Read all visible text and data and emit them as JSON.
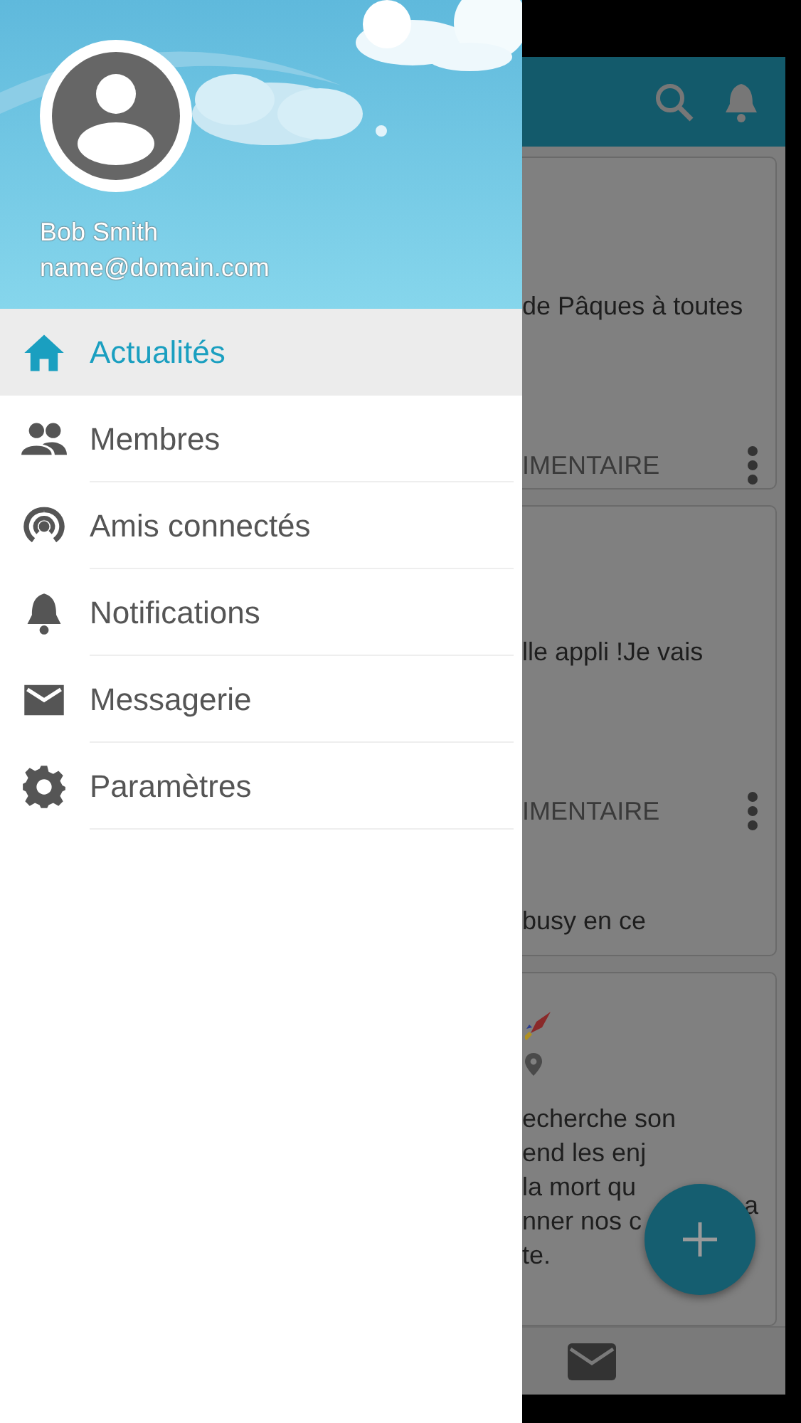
{
  "drawer": {
    "user": {
      "name": "Bob Smith",
      "email": "name@domain.com"
    },
    "items": [
      {
        "label": "Actualités",
        "selected": true
      },
      {
        "label": "Membres",
        "selected": false
      },
      {
        "label": "Amis connectés",
        "selected": false
      },
      {
        "label": "Notifications",
        "selected": false
      },
      {
        "label": "Messagerie",
        "selected": false
      },
      {
        "label": "Paramètres",
        "selected": false
      }
    ]
  },
  "feed": {
    "cards": [
      {
        "lines": [
          "de Pâques à toutes"
        ],
        "action": "IMENTAIRE"
      },
      {
        "lines": [
          "lle appli !Je vais"
        ],
        "action": "IMENTAIRE",
        "after": "busy en ce"
      },
      {
        "lines": [
          "echerche son",
          "end les enj",
          "la mort qu",
          "nner nos c",
          "te."
        ],
        "side_text": "a"
      }
    ]
  }
}
